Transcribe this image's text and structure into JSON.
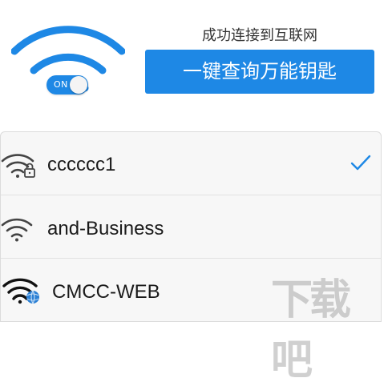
{
  "header": {
    "wifi_icon": "wifi-signal-icon",
    "toggle_label": "ON",
    "toggle_state": "on",
    "status_text": "成功连接到互联网",
    "key_button_label": "一键查询万能钥匙"
  },
  "networks": [
    {
      "name": "cccccc1",
      "icon": "wifi-lock-icon",
      "connected": true
    },
    {
      "name": "and-Business",
      "icon": "wifi-icon",
      "connected": false
    },
    {
      "name": "CMCC-WEB",
      "icon": "wifi-globe-icon",
      "connected": false
    }
  ],
  "colors": {
    "accent": "#1e88e5",
    "check": "#1e88e5"
  },
  "watermark": "下载吧"
}
